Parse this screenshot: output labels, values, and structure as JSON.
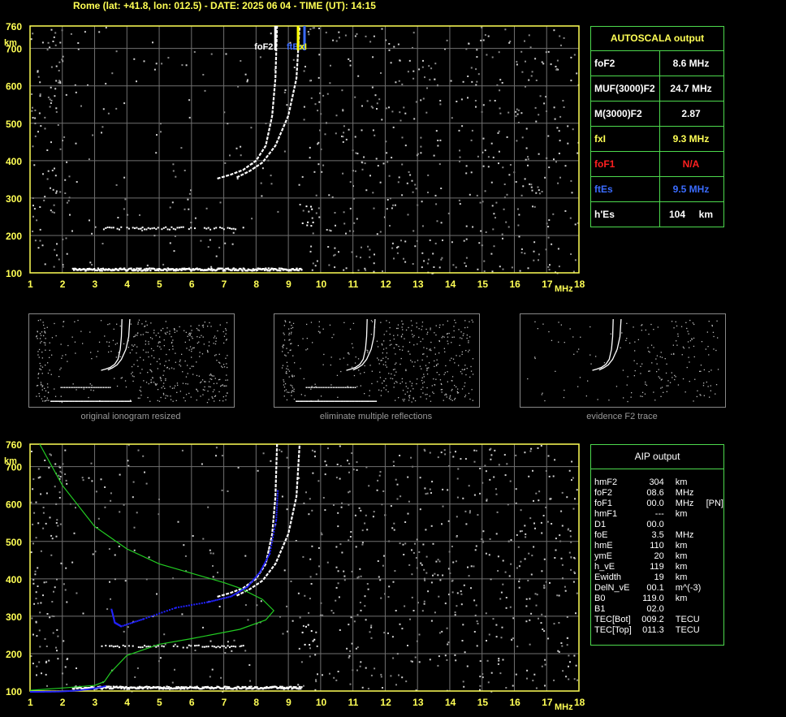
{
  "header": "Rome (lat: +41.8, lon: 012.5) - DATE: 2025 06 04 - TIME (UT): 14:15",
  "colors": {
    "axis": "#ffff55",
    "grid": "#707070",
    "box": "#4dd94d",
    "trace_white": "#ffffff",
    "trace_blue": "#2222ff",
    "profile_green": "#22cc22",
    "foF2_marker": "#ffffff",
    "ftEs_marker": "#3b6cff",
    "fxI_marker": "#ffff00",
    "foF1_color": "#ff2020",
    "ftEs_color": "#3b6cff",
    "fxI_color": "#ffff55"
  },
  "autoscala": {
    "title": "AUTOSCALA output",
    "rows": [
      {
        "key": "foF2",
        "value": "8.6 MHz",
        "color": "#ffffff"
      },
      {
        "key": "MUF(3000)F2",
        "value": "24.7 MHz",
        "color": "#ffffff"
      },
      {
        "key": "M(3000)F2",
        "value": "2.87",
        "color": "#ffffff"
      },
      {
        "key": "fxI",
        "value": "9.3 MHz",
        "color": "#ffff55"
      },
      {
        "key": "foF1",
        "value": "N/A",
        "color": "#ff2020"
      },
      {
        "key": "ftEs",
        "value": "9.5 MHz",
        "color": "#3b6cff"
      },
      {
        "key": "h'Es",
        "value": "104     km",
        "color": "#ffffff"
      }
    ]
  },
  "aip": {
    "title": "AIP output",
    "rows": [
      {
        "k": "hmF2",
        "v": "304",
        "u": "km",
        "x": ""
      },
      {
        "k": "foF2",
        "v": "08.6",
        "u": "MHz",
        "x": ""
      },
      {
        "k": "foF1",
        "v": "00.0",
        "u": "MHz",
        "x": "[PN]"
      },
      {
        "k": "hmF1",
        "v": "---",
        "u": "km",
        "x": ""
      },
      {
        "k": "D1",
        "v": "00.0",
        "u": "",
        "x": ""
      },
      {
        "k": "foE",
        "v": "3.5",
        "u": "MHz",
        "x": ""
      },
      {
        "k": "hmE",
        "v": "110",
        "u": "km",
        "x": ""
      },
      {
        "k": "ymE",
        "v": "20",
        "u": "km",
        "x": ""
      },
      {
        "k": "h_vE",
        "v": "119",
        "u": "km",
        "x": ""
      },
      {
        "k": "Ewidth",
        "v": "19",
        "u": "km",
        "x": ""
      },
      {
        "k": "DelN_vE",
        "v": "00.1",
        "u": "m^(-3)",
        "x": ""
      },
      {
        "k": "B0",
        "v": "119.0",
        "u": "km",
        "x": ""
      },
      {
        "k": "B1",
        "v": "02.0",
        "u": "",
        "x": ""
      },
      {
        "k": "TEC[Bot]",
        "v": "009.2",
        "u": "TECU",
        "x": ""
      },
      {
        "k": "TEC[Top]",
        "v": "011.3",
        "u": "TECU",
        "x": ""
      }
    ]
  },
  "thumbs": {
    "captions": [
      "original ionogram resized",
      "eliminate multiple reflections",
      "evidence F2 trace"
    ]
  },
  "chart_data": [
    {
      "type": "scatter",
      "name": "ionogram",
      "xlabel": "MHz",
      "ylabel": "km",
      "xlim": [
        1,
        18
      ],
      "ylim": [
        100,
        760
      ],
      "xticks": [
        "1",
        "2",
        "3",
        "4",
        "5",
        "6",
        "7",
        "8",
        "9",
        "10",
        "11",
        "12",
        "13",
        "14",
        "15",
        "16",
        "17",
        "18"
      ],
      "yticks": [
        "100",
        "200",
        "300",
        "400",
        "500",
        "600",
        "700",
        "760"
      ],
      "grid": true,
      "markers": [
        {
          "label": "foF2",
          "freq": 8.6
        },
        {
          "label": "ftEs",
          "freq": 9.5
        },
        {
          "label": "fxI",
          "freq": 9.3
        }
      ],
      "traces": {
        "Es": {
          "f0": 2.3,
          "f1": 9.4,
          "h": 110
        },
        "Es2": {
          "f0": 3.2,
          "f1": 7.6,
          "h": 220
        },
        "F2o": [
          [
            6.8,
            352
          ],
          [
            7.2,
            362
          ],
          [
            7.6,
            375
          ],
          [
            8.0,
            400
          ],
          [
            8.3,
            440
          ],
          [
            8.5,
            520
          ],
          [
            8.6,
            620
          ],
          [
            8.65,
            760
          ]
        ],
        "F2x": [
          [
            7.4,
            355
          ],
          [
            7.8,
            372
          ],
          [
            8.2,
            395
          ],
          [
            8.6,
            440
          ],
          [
            9.0,
            520
          ],
          [
            9.25,
            620
          ],
          [
            9.35,
            760
          ]
        ]
      }
    },
    {
      "type": "line",
      "name": "aip",
      "xlabel": "MHz",
      "ylabel": "km",
      "xlim": [
        1,
        18
      ],
      "ylim": [
        100,
        760
      ],
      "xticks": [
        "1",
        "2",
        "3",
        "4",
        "5",
        "6",
        "7",
        "8",
        "9",
        "10",
        "11",
        "12",
        "13",
        "14",
        "15",
        "16",
        "17",
        "18"
      ],
      "yticks": [
        "100",
        "200",
        "300",
        "400",
        "500",
        "600",
        "700",
        "760"
      ],
      "grid": true,
      "profile": [
        [
          1.3,
          760
        ],
        [
          2.0,
          650
        ],
        [
          3.0,
          540
        ],
        [
          4.0,
          480
        ],
        [
          5.0,
          440
        ],
        [
          6.0,
          415
        ],
        [
          7.0,
          390
        ],
        [
          7.5,
          375
        ],
        [
          8.2,
          345
        ],
        [
          8.55,
          315
        ],
        [
          8.3,
          290
        ],
        [
          7.5,
          265
        ],
        [
          6.0,
          240
        ],
        [
          5.0,
          225
        ],
        [
          4.0,
          195
        ],
        [
          3.5,
          150
        ],
        [
          3.3,
          125
        ],
        [
          3.0,
          115
        ],
        [
          2.0,
          108
        ],
        [
          1.0,
          102
        ]
      ],
      "recon": [
        [
          3.5,
          320
        ],
        [
          3.6,
          285
        ],
        [
          3.8,
          275
        ],
        [
          4.5,
          295
        ],
        [
          5.5,
          325
        ],
        [
          6.5,
          340
        ],
        [
          7.2,
          355
        ],
        [
          7.7,
          380
        ],
        [
          8.1,
          420
        ],
        [
          8.4,
          470
        ],
        [
          8.6,
          560
        ],
        [
          8.65,
          640
        ]
      ],
      "trace_o": [
        [
          6.8,
          352
        ],
        [
          7.2,
          362
        ],
        [
          7.6,
          375
        ],
        [
          8.0,
          400
        ],
        [
          8.3,
          440
        ],
        [
          8.5,
          520
        ],
        [
          8.6,
          620
        ],
        [
          8.65,
          760
        ]
      ],
      "trace_x": [
        [
          7.4,
          355
        ],
        [
          7.8,
          372
        ],
        [
          8.2,
          395
        ],
        [
          8.6,
          440
        ],
        [
          9.0,
          520
        ],
        [
          9.25,
          620
        ],
        [
          9.35,
          760
        ]
      ],
      "Es": {
        "f0": 2.3,
        "f1": 9.4,
        "h": 110
      },
      "Es2": {
        "f0": 3.2,
        "f1": 7.6,
        "h": 220
      }
    }
  ]
}
